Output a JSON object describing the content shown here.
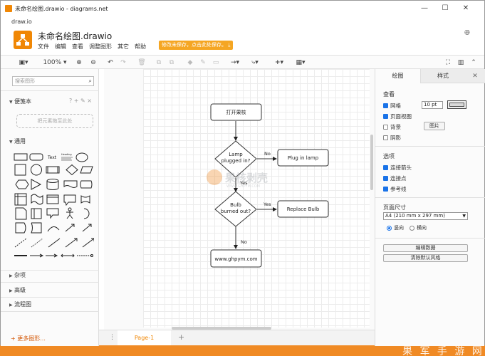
{
  "window": {
    "title": "未命名绘图.drawio - diagrams.net",
    "app_name": "draw.io",
    "controls": [
      "minimize-icon",
      "maximize-icon",
      "close-icon"
    ]
  },
  "header": {
    "doc_title": "未命名绘图.drawio",
    "menu": [
      "文件",
      "编辑",
      "查看",
      "调整图形",
      "其它",
      "帮助"
    ],
    "save_notice": "修改未保存，点击此处保存。"
  },
  "toolbar": {
    "zoom": "100%"
  },
  "sidebar": {
    "search_placeholder": "搜索图形",
    "scratchpad": "便笺本",
    "scratchpad_tools": "? + ✎ ×",
    "drop_hint": "把元素拖至此处",
    "general": "通用",
    "shape_text": "Text",
    "shape_heading": "Heading",
    "misc": "杂项",
    "advanced": "高级",
    "flowchart": "流程图",
    "more_shapes": "+ 更多图形..."
  },
  "diagram": {
    "start": "打开果核",
    "decision1": "Lamp plugged in?",
    "action1": "Plug in lamp",
    "decision2": "Bulb burned out?",
    "action2": "Replace Bulb",
    "end": "www.ghpym.com",
    "no1": "No",
    "yes1": "Yes",
    "yes2": "Yes",
    "no2": "No"
  },
  "pagetabs": {
    "tab1": "Page-1"
  },
  "panel": {
    "tab_diagram": "绘图",
    "tab_style": "样式",
    "view_label": "查看",
    "grid": "网格",
    "grid_size": "10 pt",
    "page_view": "页面视图",
    "background": "背景",
    "image_btn": "图片",
    "shadow": "阴影",
    "options_label": "选项",
    "connection_arrows": "连接箭头",
    "connection_points": "连接点",
    "guides": "参考线",
    "page_size_label": "页面尺寸",
    "page_size_value": "A4 (210 mm x 297 mm)",
    "portrait": "竖向",
    "landscape": "横向",
    "edit_data": "编辑数据",
    "clear_style": "清除默认风格"
  },
  "watermark": {
    "center": "果核剥壳",
    "center_url": "WWW.GHPYM.COM",
    "corner": "果 军 手 游 网"
  }
}
